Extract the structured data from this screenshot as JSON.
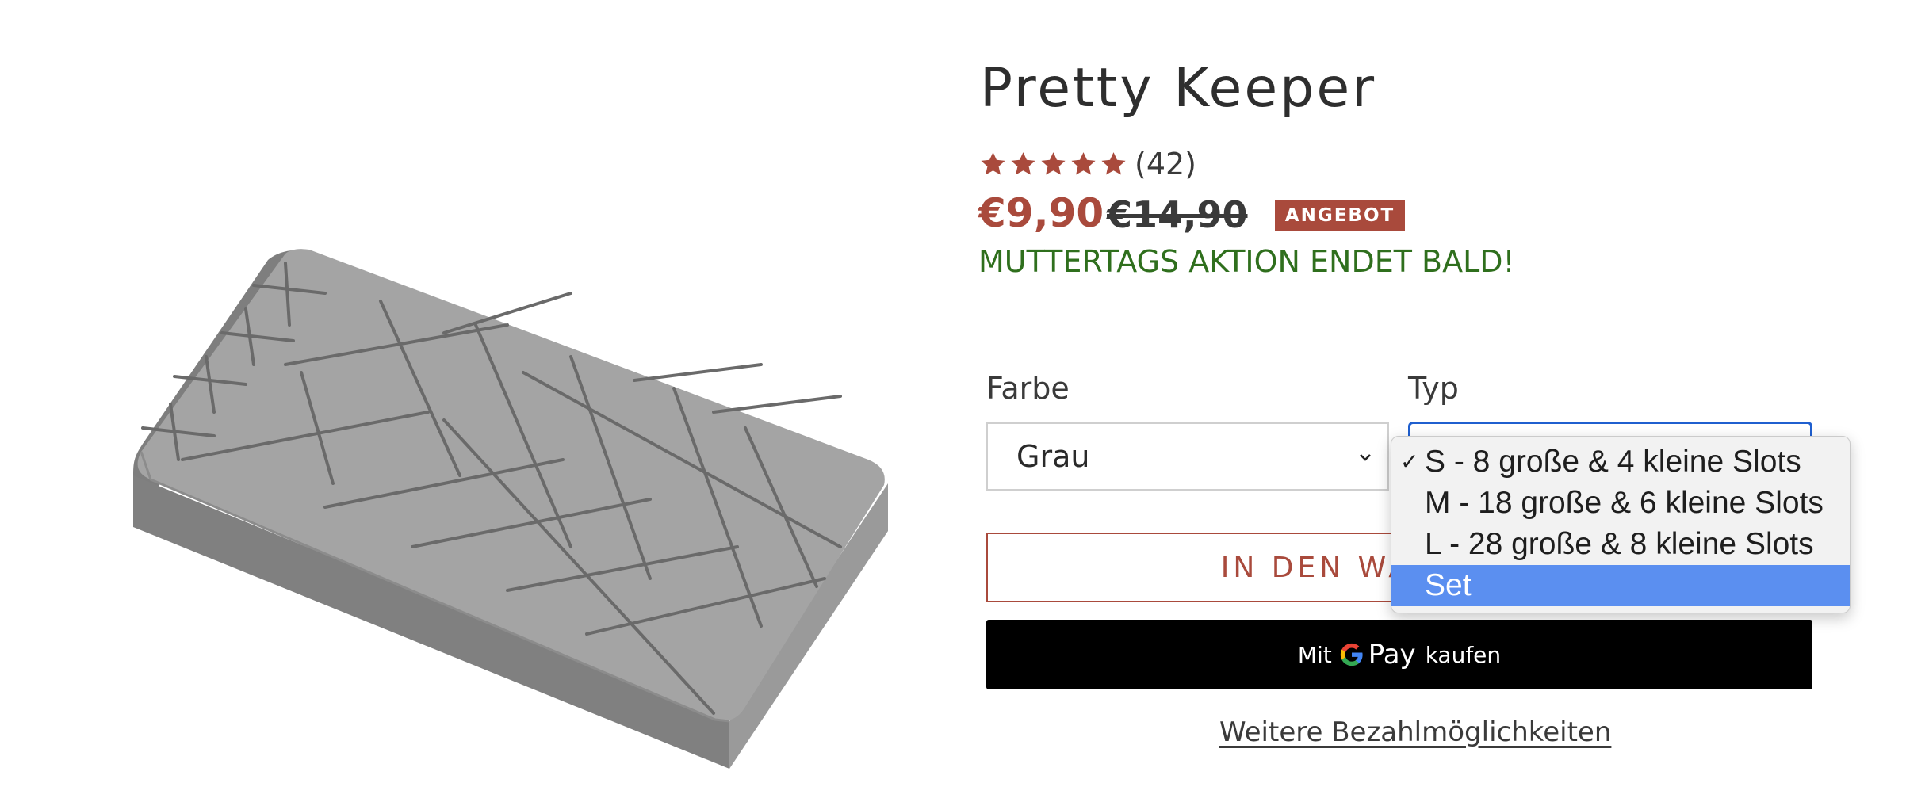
{
  "product": {
    "title": "Pretty Keeper",
    "rating_stars": 5,
    "review_count": "(42)",
    "price": "€9,90",
    "compare_price": "€14,90",
    "sale_badge": "ANGEBOT",
    "promo_text": "MUTTERTAGS AKTION ENDET BALD!"
  },
  "options": {
    "color": {
      "label": "Farbe",
      "value": "Grau"
    },
    "type": {
      "label": "Typ",
      "items": [
        {
          "label": "S - 8 große & 4 kleine Slots",
          "checked": true,
          "highlighted": false
        },
        {
          "label": "M - 18 große & 6 kleine Slots",
          "checked": false,
          "highlighted": false
        },
        {
          "label": "L - 28 große & 8 kleine Slots",
          "checked": false,
          "highlighted": false
        },
        {
          "label": "Set",
          "checked": false,
          "highlighted": true
        }
      ]
    }
  },
  "buttons": {
    "add_to_cart": "IN DEN WARENKORB",
    "gpay_prefix": "Mit",
    "gpay_pay": "Pay",
    "gpay_suffix": "kaufen",
    "more_payment": "Weitere Bezahlmöglichkeiten"
  },
  "colors": {
    "accent": "#a94a3c",
    "promo": "#2f6f1d",
    "focus": "#1f5fcf",
    "dropdown_highlight": "#5b8ff0"
  },
  "icons": [
    "star-icon",
    "chevron-down-icon",
    "checkmark-icon",
    "google-g-icon"
  ]
}
